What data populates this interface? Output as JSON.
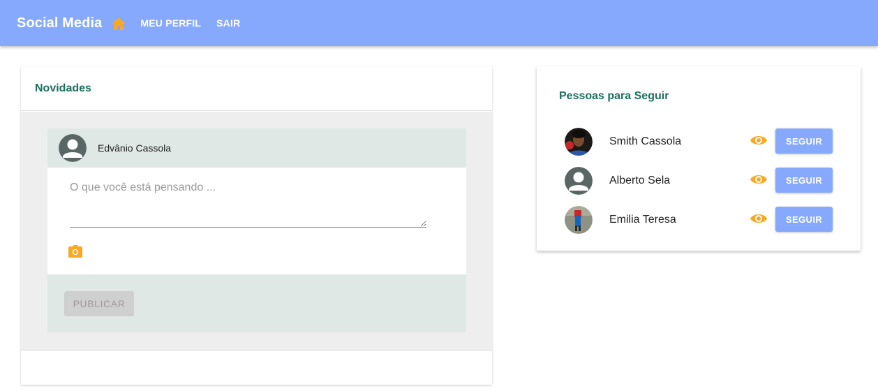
{
  "appbar": {
    "brand": "Social Media",
    "home_icon": "home-icon",
    "nav": [
      {
        "label": "MEU PERFIL"
      },
      {
        "label": "SAIR"
      }
    ]
  },
  "feed": {
    "title": "Novidades",
    "composer": {
      "author": "Edvânio Cassola",
      "placeholder": "O que você está pensando ...",
      "camera_icon": "camera-icon",
      "publish_label": "PUBLICAR"
    }
  },
  "suggestions": {
    "title": "Pessoas para Seguir",
    "people": [
      {
        "name": "Smith Cassola",
        "avatar": "photo",
        "follow_label": "SEGUIR"
      },
      {
        "name": "Alberto Sela",
        "avatar": "default-avatar",
        "follow_label": "SEGUIR"
      },
      {
        "name": "Emilia Teresa",
        "avatar": "photo",
        "follow_label": "SEGUIR"
      }
    ]
  },
  "colors": {
    "appbar": "#86a8fd",
    "accent": "#1b6e5a",
    "icon_orange": "#f9a825",
    "panel_green": "#dfe8e4"
  }
}
